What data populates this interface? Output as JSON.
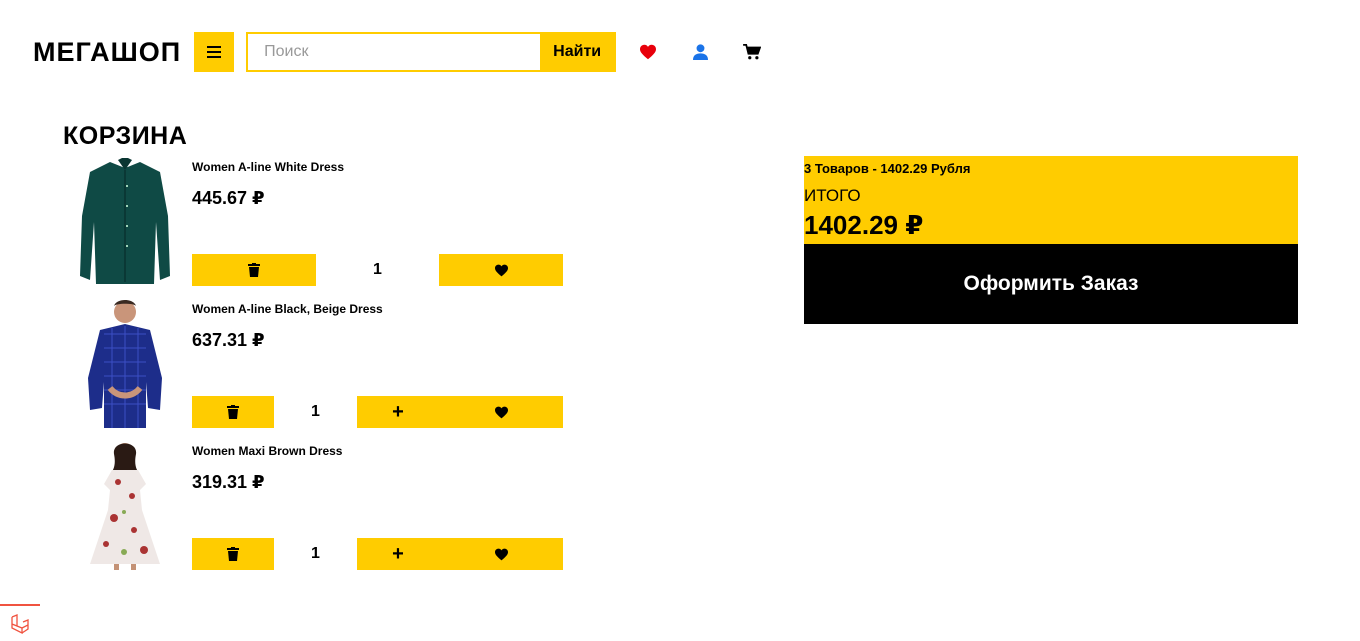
{
  "header": {
    "logo": "МЕГАШОП",
    "search_placeholder": "Поиск",
    "search_button": "Найти"
  },
  "page_title": "КОРЗИНА",
  "items": [
    {
      "name": "Women A-line White Dress",
      "price": "445.67 ₽",
      "qty": "1",
      "plus": ""
    },
    {
      "name": "Women A-line Black, Beige Dress",
      "price": "637.31 ₽",
      "qty": "1",
      "plus": "+"
    },
    {
      "name": "Women Maxi Brown Dress",
      "price": "319.31 ₽",
      "qty": "1",
      "plus": "+"
    }
  ],
  "summary": {
    "count_line": "3 Товаров - 1402.29 Рубля",
    "total_label": "ИТОГО",
    "total_value": "1402.29 ₽",
    "checkout_button": "Оформить Заказ"
  },
  "colors": {
    "accent": "#ffcc00",
    "heart": "#e8000b",
    "user": "#1a73e8"
  }
}
